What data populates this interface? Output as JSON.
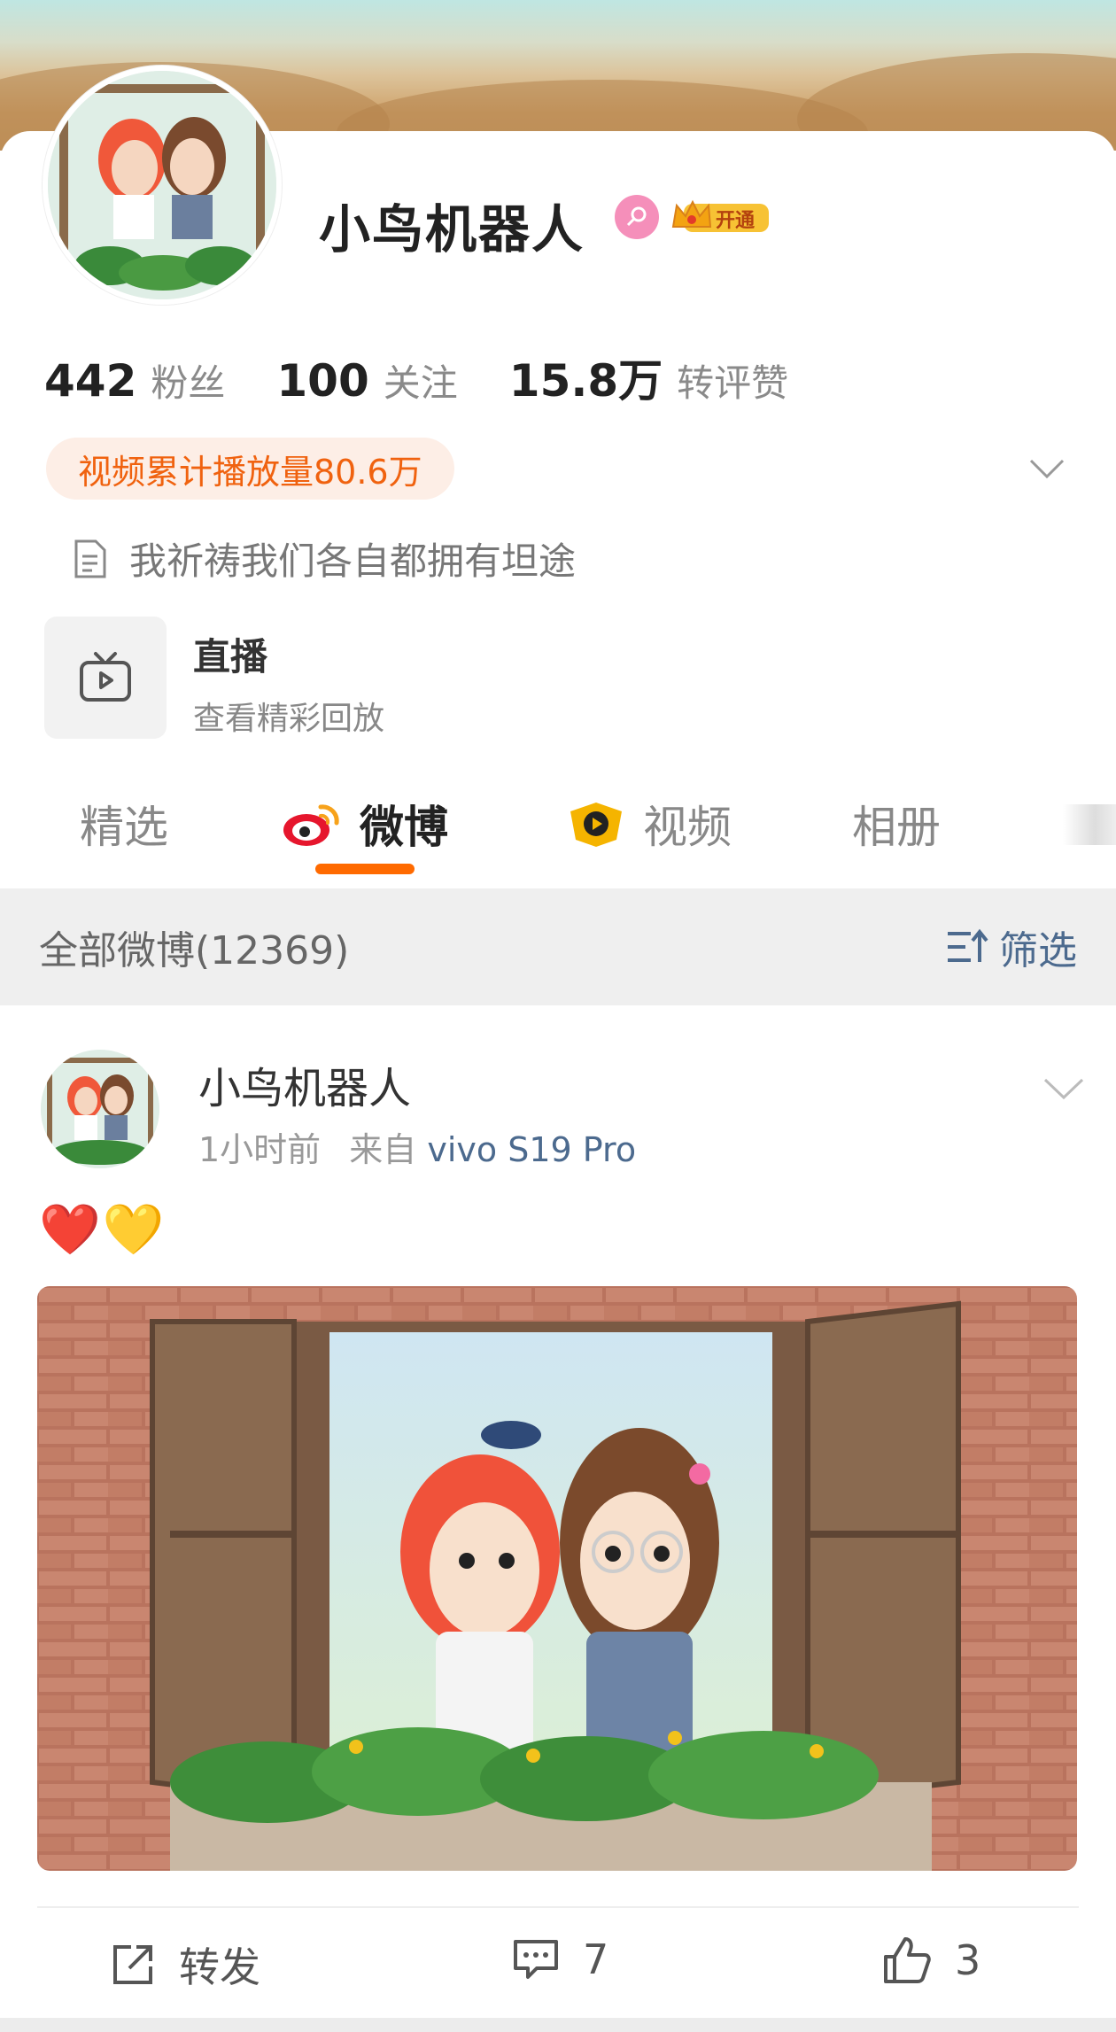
{
  "profile": {
    "username": "小鸟机器人",
    "vip_label": "开通",
    "stats": [
      {
        "value": "442",
        "label": "粉丝"
      },
      {
        "value": "100",
        "label": "关注"
      },
      {
        "value": "15.8万",
        "label": "转评赞"
      }
    ],
    "video_play_count": "视频累计播放量80.6万",
    "bio": "我祈祷我们各自都拥有坦途",
    "live": {
      "title": "直播",
      "subtitle": "查看精彩回放"
    }
  },
  "tabs": [
    {
      "label": "精选",
      "icon": null
    },
    {
      "label": "微博",
      "icon": "weibo-logo-icon",
      "active": true
    },
    {
      "label": "视频",
      "icon": "video-channel-icon"
    },
    {
      "label": "相册",
      "icon": null
    }
  ],
  "filter_bar": {
    "all_posts": "全部微博(12369)",
    "filter_label": "筛选"
  },
  "post": {
    "author": "小鸟机器人",
    "time": "1小时前",
    "from_prefix": "来自",
    "source": "vivo S19 Pro",
    "text": "❤️💛",
    "actions": {
      "repost": "转发",
      "comments": "7",
      "likes": "3"
    }
  },
  "colors": {
    "accent": "#ff6a00",
    "link": "#4c6a8e",
    "pill_bg": "#fdeee6",
    "pill_text": "#f0620f",
    "female_badge": "#f58fba"
  }
}
